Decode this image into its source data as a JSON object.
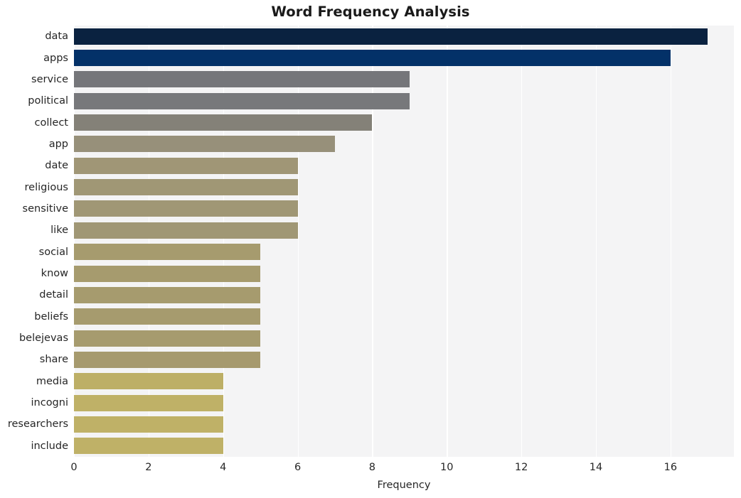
{
  "chart_data": {
    "type": "bar",
    "orientation": "horizontal",
    "title": "Word Frequency Analysis",
    "xlabel": "Frequency",
    "ylabel": "",
    "categories": [
      "data",
      "apps",
      "service",
      "political",
      "collect",
      "app",
      "date",
      "religious",
      "sensitive",
      "like",
      "social",
      "know",
      "detail",
      "beliefs",
      "belejevas",
      "share",
      "media",
      "incogni",
      "researchers",
      "include"
    ],
    "values": [
      17,
      16,
      9,
      9,
      8,
      7,
      6,
      6,
      6,
      6,
      5,
      5,
      5,
      5,
      5,
      5,
      4,
      4,
      4,
      4
    ],
    "bar_colors": [
      "#0a2240",
      "#033168",
      "#75767a",
      "#77787b",
      "#848178",
      "#97907a",
      "#a09676",
      "#a09775",
      "#a09775",
      "#a09775",
      "#a69b6e",
      "#a69b6e",
      "#a69b6e",
      "#a69b6e",
      "#a69b6e",
      "#a69a6e",
      "#bdaf66",
      "#bfb167",
      "#bfb167",
      "#bfb167"
    ],
    "xlim": [
      0,
      17.7
    ],
    "xticks": [
      0,
      2,
      4,
      6,
      8,
      10,
      12,
      14,
      16
    ],
    "xticklabels": [
      "0",
      "2",
      "4",
      "6",
      "8",
      "10",
      "12",
      "14",
      "16"
    ],
    "grid": true,
    "grid_axis": "x",
    "grid_color": "#ffffff",
    "plot_background": "#f4f4f5",
    "figure_background": "#ffffff",
    "legend": null
  }
}
